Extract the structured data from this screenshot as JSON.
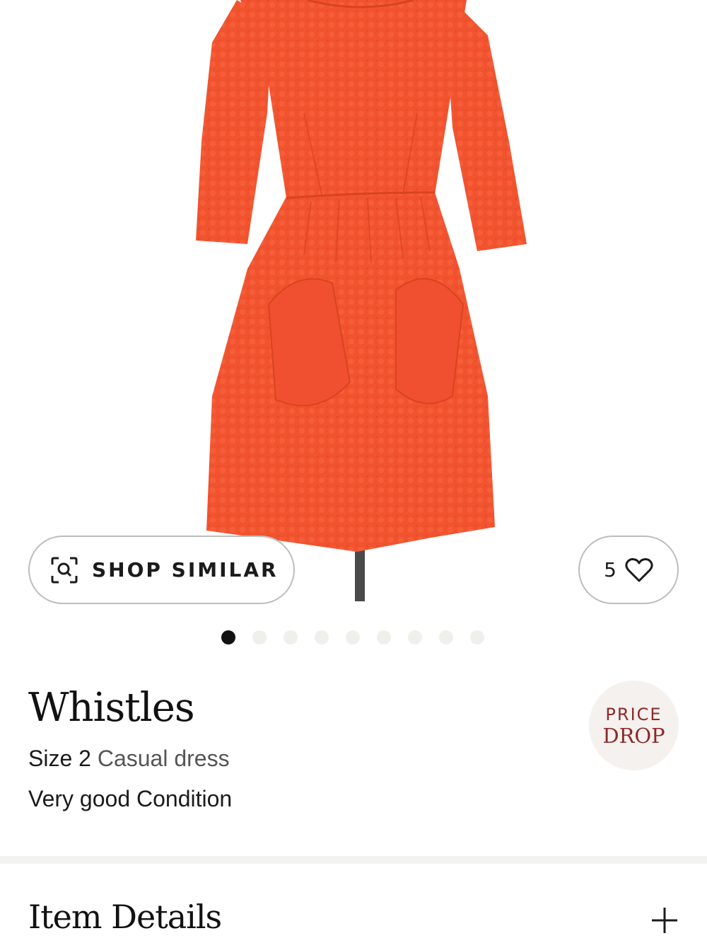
{
  "product_image": {
    "alt_icon": "dress-photo",
    "dress_color": "#f2532f"
  },
  "shop_similar": {
    "label": "SHOP SIMILAR",
    "icon": "visual-search-icon"
  },
  "favorite": {
    "count": "5",
    "icon": "heart-icon"
  },
  "carousel": {
    "total": 9,
    "active_index": 0
  },
  "product": {
    "brand": "Whistles",
    "size": "Size 2",
    "type": "Casual dress",
    "condition": "Very good Condition"
  },
  "badge": {
    "line1": "PRICE",
    "line2": "DROP",
    "color": "#8c2a2a"
  },
  "details": {
    "title": "Item Details",
    "icon": "plus-icon"
  }
}
